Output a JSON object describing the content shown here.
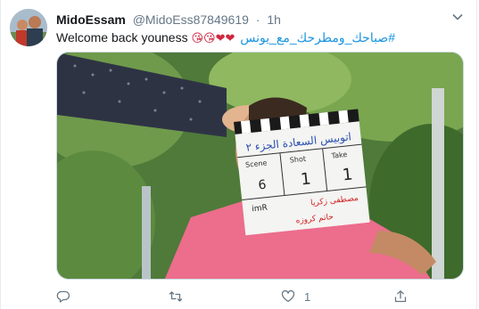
{
  "tweet": {
    "author_name": "MidoEssam",
    "author_handle": "@MidoEss87849619",
    "separator": "·",
    "time": "1h",
    "text": "Welcome back youness",
    "emojis": "😘😘❤❤",
    "hashtag": "#صباحك_ومطرحك_مع_يونس",
    "clapperboard": {
      "title": "اتوبيس السعادة الجزء ٢",
      "scene_label": "Scene",
      "shot_label": "Shot",
      "take_label": "Take",
      "shot_value": "1",
      "take_value": "1",
      "scene_value": "6",
      "director": "مصطفى زكريا",
      "cinematographer": "حاتم كروزه",
      "camera": "imR"
    },
    "like_count": "1"
  },
  "icons": {
    "caret": "chevron-down-icon",
    "reply": "reply-icon",
    "retweet": "retweet-icon",
    "like": "heart-icon",
    "share": "share-icon"
  },
  "colors": {
    "link": "#1b95e0",
    "muted": "#657786",
    "text": "#14171a"
  }
}
